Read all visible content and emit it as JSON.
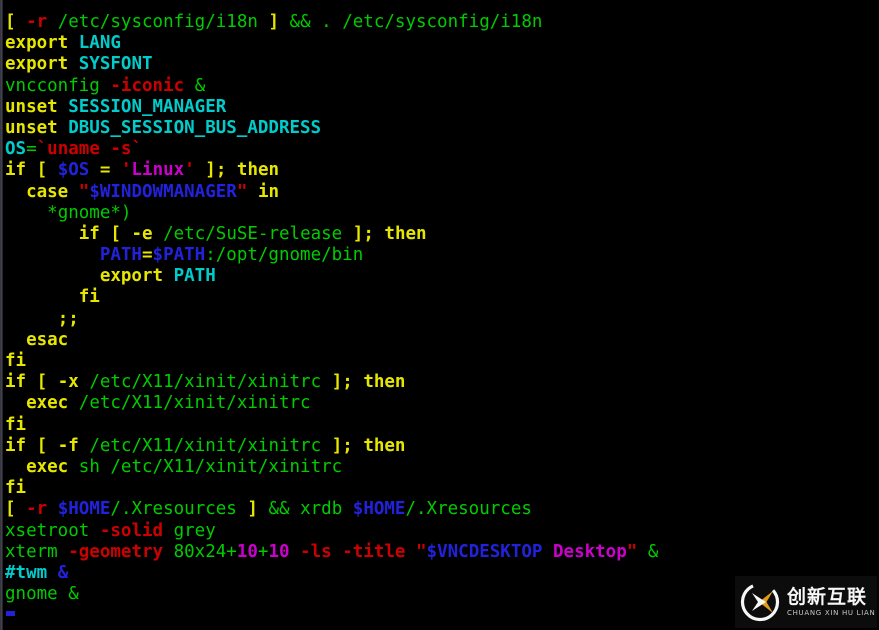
{
  "terminal": {
    "background_color": "#000000",
    "default_text_color": "#c8c8c8",
    "palette": {
      "green": "#00cc00",
      "yellow": "#e6e600",
      "red": "#cc0000",
      "blue": "#2222dd",
      "cyan": "#00cccc",
      "magenta": "#cc00cc",
      "white": "#e5e5e5"
    },
    "cursor_color": "#2222dd",
    "lines": [
      {
        "index": 1,
        "text": "[ -r /etc/sysconfig/i18n ] && . /etc/sysconfig/i18n",
        "spans": [
          {
            "t": "[",
            "c": "yellow"
          },
          {
            "t": " ",
            "c": "default"
          },
          {
            "t": "-r",
            "c": "red"
          },
          {
            "t": " ",
            "c": "default"
          },
          {
            "t": "/etc/sysconfig/i18n",
            "c": "green"
          },
          {
            "t": " ",
            "c": "default"
          },
          {
            "t": "]",
            "c": "yellow"
          },
          {
            "t": " ",
            "c": "default"
          },
          {
            "t": "&& . /etc/sysconfig/i18n",
            "c": "green"
          }
        ]
      },
      {
        "index": 2,
        "text": "export LANG",
        "spans": [
          {
            "t": "export",
            "c": "yellow"
          },
          {
            "t": " ",
            "c": "default"
          },
          {
            "t": "LANG",
            "c": "cyan"
          }
        ]
      },
      {
        "index": 3,
        "text": "export SYSFONT",
        "spans": [
          {
            "t": "export",
            "c": "yellow"
          },
          {
            "t": " ",
            "c": "default"
          },
          {
            "t": "SYSFONT",
            "c": "cyan"
          }
        ]
      },
      {
        "index": 4,
        "text": "vncconfig -iconic &",
        "spans": [
          {
            "t": "vncconfig",
            "c": "green"
          },
          {
            "t": " ",
            "c": "default"
          },
          {
            "t": "-iconic",
            "c": "red"
          },
          {
            "t": " ",
            "c": "default"
          },
          {
            "t": "&",
            "c": "green"
          }
        ]
      },
      {
        "index": 5,
        "text": "unset SESSION_MANAGER",
        "spans": [
          {
            "t": "unset",
            "c": "yellow"
          },
          {
            "t": " ",
            "c": "default"
          },
          {
            "t": "SESSION_MANAGER",
            "c": "cyan"
          }
        ]
      },
      {
        "index": 6,
        "text": "unset DBUS_SESSION_BUS_ADDRESS",
        "spans": [
          {
            "t": "unset",
            "c": "yellow"
          },
          {
            "t": " ",
            "c": "default"
          },
          {
            "t": "DBUS_SESSION_BUS_ADDRESS",
            "c": "cyan"
          }
        ]
      },
      {
        "index": 7,
        "text": "OS=`uname -s`",
        "spans": [
          {
            "t": "OS",
            "c": "cyan"
          },
          {
            "t": "=",
            "c": "green"
          },
          {
            "t": "`",
            "c": "red"
          },
          {
            "t": "uname -s",
            "c": "red"
          },
          {
            "t": "`",
            "c": "red"
          }
        ]
      },
      {
        "index": 8,
        "text": "if [ $OS = 'Linux' ]; then",
        "spans": [
          {
            "t": "if",
            "c": "yellow"
          },
          {
            "t": " ",
            "c": "default"
          },
          {
            "t": "[",
            "c": "yellow"
          },
          {
            "t": " ",
            "c": "default"
          },
          {
            "t": "$OS",
            "c": "blue"
          },
          {
            "t": " ",
            "c": "default"
          },
          {
            "t": "=",
            "c": "yellow"
          },
          {
            "t": " ",
            "c": "default"
          },
          {
            "t": "'",
            "c": "red"
          },
          {
            "t": "Linux",
            "c": "magenta"
          },
          {
            "t": "'",
            "c": "red"
          },
          {
            "t": " ",
            "c": "default"
          },
          {
            "t": "];",
            "c": "yellow"
          },
          {
            "t": " ",
            "c": "default"
          },
          {
            "t": "then",
            "c": "yellow"
          }
        ]
      },
      {
        "index": 9,
        "text": "  case \"$WINDOWMANAGER\" in",
        "spans": [
          {
            "t": "  ",
            "c": "default"
          },
          {
            "t": "case",
            "c": "yellow"
          },
          {
            "t": " ",
            "c": "default"
          },
          {
            "t": "\"",
            "c": "red"
          },
          {
            "t": "$WINDOWMANAGER",
            "c": "blue"
          },
          {
            "t": "\"",
            "c": "red"
          },
          {
            "t": " ",
            "c": "default"
          },
          {
            "t": "in",
            "c": "yellow"
          }
        ]
      },
      {
        "index": 10,
        "text": "    *gnome*)",
        "spans": [
          {
            "t": "    ",
            "c": "default"
          },
          {
            "t": "*gnome*)",
            "c": "green"
          }
        ]
      },
      {
        "index": 11,
        "text": "       if [ -e /etc/SuSE-release ]; then",
        "spans": [
          {
            "t": "       ",
            "c": "default"
          },
          {
            "t": "if",
            "c": "yellow"
          },
          {
            "t": " ",
            "c": "default"
          },
          {
            "t": "[",
            "c": "yellow"
          },
          {
            "t": " ",
            "c": "default"
          },
          {
            "t": "-e",
            "c": "yellow"
          },
          {
            "t": " ",
            "c": "default"
          },
          {
            "t": "/etc/SuSE-release",
            "c": "green"
          },
          {
            "t": " ",
            "c": "default"
          },
          {
            "t": "];",
            "c": "yellow"
          },
          {
            "t": " ",
            "c": "default"
          },
          {
            "t": "then",
            "c": "yellow"
          }
        ]
      },
      {
        "index": 12,
        "text": "         PATH=$PATH:/opt/gnome/bin",
        "spans": [
          {
            "t": "         ",
            "c": "default"
          },
          {
            "t": "PATH",
            "c": "blue"
          },
          {
            "t": "=",
            "c": "yellow"
          },
          {
            "t": "$PATH",
            "c": "blue"
          },
          {
            "t": ":/opt/gnome/bin",
            "c": "green"
          }
        ]
      },
      {
        "index": 13,
        "text": "         export PATH",
        "spans": [
          {
            "t": "         ",
            "c": "default"
          },
          {
            "t": "export",
            "c": "yellow"
          },
          {
            "t": " ",
            "c": "default"
          },
          {
            "t": "PATH",
            "c": "cyan"
          }
        ]
      },
      {
        "index": 14,
        "text": "       fi",
        "spans": [
          {
            "t": "       ",
            "c": "default"
          },
          {
            "t": "fi",
            "c": "yellow"
          }
        ]
      },
      {
        "index": 15,
        "text": "     ;;",
        "spans": [
          {
            "t": "     ",
            "c": "default"
          },
          {
            "t": ";;",
            "c": "yellow"
          }
        ]
      },
      {
        "index": 16,
        "text": "  esac",
        "spans": [
          {
            "t": "  ",
            "c": "default"
          },
          {
            "t": "esac",
            "c": "yellow"
          }
        ]
      },
      {
        "index": 17,
        "text": "fi",
        "spans": [
          {
            "t": "fi",
            "c": "yellow"
          }
        ]
      },
      {
        "index": 18,
        "text": "if [ -x /etc/X11/xinit/xinitrc ]; then",
        "spans": [
          {
            "t": "if",
            "c": "yellow"
          },
          {
            "t": " ",
            "c": "default"
          },
          {
            "t": "[",
            "c": "yellow"
          },
          {
            "t": " ",
            "c": "default"
          },
          {
            "t": "-x",
            "c": "yellow"
          },
          {
            "t": " ",
            "c": "default"
          },
          {
            "t": "/etc/X11/xinit/xinitrc",
            "c": "green"
          },
          {
            "t": " ",
            "c": "default"
          },
          {
            "t": "];",
            "c": "yellow"
          },
          {
            "t": " ",
            "c": "default"
          },
          {
            "t": "then",
            "c": "yellow"
          }
        ]
      },
      {
        "index": 19,
        "text": "  exec /etc/X11/xinit/xinitrc",
        "spans": [
          {
            "t": "  ",
            "c": "default"
          },
          {
            "t": "exec",
            "c": "yellow"
          },
          {
            "t": " ",
            "c": "default"
          },
          {
            "t": "/etc/X11/xinit/xinitrc",
            "c": "green"
          }
        ]
      },
      {
        "index": 20,
        "text": "fi",
        "spans": [
          {
            "t": "fi",
            "c": "yellow"
          }
        ]
      },
      {
        "index": 21,
        "text": "if [ -f /etc/X11/xinit/xinitrc ]; then",
        "spans": [
          {
            "t": "if",
            "c": "yellow"
          },
          {
            "t": " ",
            "c": "default"
          },
          {
            "t": "[",
            "c": "yellow"
          },
          {
            "t": " ",
            "c": "default"
          },
          {
            "t": "-f",
            "c": "yellow"
          },
          {
            "t": " ",
            "c": "default"
          },
          {
            "t": "/etc/X11/xinit/xinitrc",
            "c": "green"
          },
          {
            "t": " ",
            "c": "default"
          },
          {
            "t": "];",
            "c": "yellow"
          },
          {
            "t": " ",
            "c": "default"
          },
          {
            "t": "then",
            "c": "yellow"
          }
        ]
      },
      {
        "index": 22,
        "text": "  exec sh /etc/X11/xinit/xinitrc",
        "spans": [
          {
            "t": "  ",
            "c": "default"
          },
          {
            "t": "exec",
            "c": "yellow"
          },
          {
            "t": " ",
            "c": "default"
          },
          {
            "t": "sh /etc/X11/xinit/xinitrc",
            "c": "green"
          }
        ]
      },
      {
        "index": 23,
        "text": "fi",
        "spans": [
          {
            "t": "fi",
            "c": "yellow"
          }
        ]
      },
      {
        "index": 24,
        "text": "[ -r $HOME/.Xresources ] && xrdb $HOME/.Xresources",
        "spans": [
          {
            "t": "[",
            "c": "yellow"
          },
          {
            "t": " ",
            "c": "default"
          },
          {
            "t": "-r",
            "c": "red"
          },
          {
            "t": " ",
            "c": "default"
          },
          {
            "t": "$HOME",
            "c": "blue"
          },
          {
            "t": "/.Xresources",
            "c": "green"
          },
          {
            "t": " ",
            "c": "default"
          },
          {
            "t": "]",
            "c": "yellow"
          },
          {
            "t": " ",
            "c": "default"
          },
          {
            "t": "&& xrdb ",
            "c": "green"
          },
          {
            "t": "$HOME",
            "c": "blue"
          },
          {
            "t": "/.Xresources",
            "c": "green"
          }
        ]
      },
      {
        "index": 25,
        "text": "xsetroot -solid grey",
        "spans": [
          {
            "t": "xsetroot",
            "c": "green"
          },
          {
            "t": " ",
            "c": "default"
          },
          {
            "t": "-solid",
            "c": "red"
          },
          {
            "t": " ",
            "c": "default"
          },
          {
            "t": "grey",
            "c": "green"
          }
        ]
      },
      {
        "index": 26,
        "text": "xterm -geometry 80x24+10+10 -ls -title \"$VNCDESKTOP Desktop\" &",
        "spans": [
          {
            "t": "xterm",
            "c": "green"
          },
          {
            "t": " ",
            "c": "default"
          },
          {
            "t": "-geometry",
            "c": "red"
          },
          {
            "t": " ",
            "c": "default"
          },
          {
            "t": "80x24+",
            "c": "green"
          },
          {
            "t": "10",
            "c": "magenta"
          },
          {
            "t": "+",
            "c": "green"
          },
          {
            "t": "10",
            "c": "magenta"
          },
          {
            "t": " ",
            "c": "default"
          },
          {
            "t": "-ls",
            "c": "red"
          },
          {
            "t": " ",
            "c": "default"
          },
          {
            "t": "-title",
            "c": "red"
          },
          {
            "t": " ",
            "c": "default"
          },
          {
            "t": "\"",
            "c": "red"
          },
          {
            "t": "$VNCDESKTOP",
            "c": "blue"
          },
          {
            "t": " ",
            "c": "default"
          },
          {
            "t": "Desktop",
            "c": "magenta"
          },
          {
            "t": "\"",
            "c": "red"
          },
          {
            "t": " ",
            "c": "default"
          },
          {
            "t": "&",
            "c": "green"
          }
        ]
      },
      {
        "index": 27,
        "text": "#twm &",
        "spans": [
          {
            "t": "#twm",
            "c": "cyan"
          },
          {
            "t": " ",
            "c": "default"
          },
          {
            "t": "&",
            "c": "blue"
          }
        ]
      },
      {
        "index": 28,
        "text": "gnome &",
        "spans": [
          {
            "t": "gnome",
            "c": "green"
          },
          {
            "t": " ",
            "c": "default"
          },
          {
            "t": "&",
            "c": "green"
          }
        ]
      }
    ]
  },
  "watermark": {
    "logo_icon": "chuangxinhulian-logo-icon",
    "chinese_text": "创新互联",
    "pinyin_text": "CHUANG XIN HU LIAN",
    "accent_color": "#e8a317"
  }
}
